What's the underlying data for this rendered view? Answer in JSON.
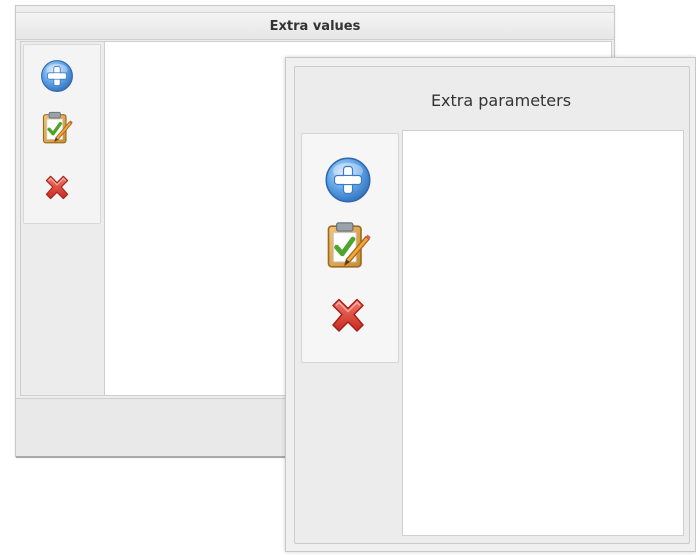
{
  "back_panel": {
    "title": "Extra values",
    "toolbar": [
      {
        "icon": "add-icon",
        "accent": "#4a8fd6"
      },
      {
        "icon": "clipboard-edit-icon",
        "accent": "#5aa832"
      },
      {
        "icon": "delete-icon",
        "accent": "#d9352c"
      }
    ]
  },
  "front_panel": {
    "title": "Extra parameters",
    "toolbar": [
      {
        "icon": "add-icon",
        "accent": "#4a8fd6"
      },
      {
        "icon": "clipboard-edit-icon",
        "accent": "#5aa832"
      },
      {
        "icon": "delete-icon",
        "accent": "#d9352c"
      }
    ]
  }
}
